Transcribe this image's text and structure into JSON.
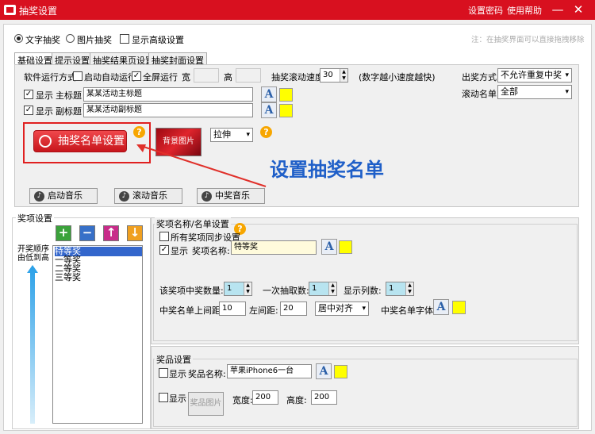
{
  "window": {
    "title": "抽奖设置",
    "links": [
      "设置密码",
      "使用帮助"
    ]
  },
  "mode": {
    "options": [
      "文字抽奖",
      "图片抽奖"
    ],
    "advanced_label": "显示高级设置",
    "hint": "注：在抽奖界面可以直接拖拽移除"
  },
  "tabs": [
    "基础设置",
    "提示设置",
    "抽奖结果页设置",
    "抽奖封面设置"
  ],
  "basic": {
    "run_mode_label": "软件运行方式",
    "auto_start": "启动自动运行",
    "fullscreen": "全屏运行",
    "width_label": "宽",
    "height_label": "高",
    "scroll_speed_label": "抽奖滚动速度",
    "scroll_speed_value": "30",
    "speed_hint": "(数字越小速度越快)",
    "show_label": "显示",
    "main_title_label": "主标题",
    "main_title_value": "某某活动主标题",
    "sub_title_label": "副标题",
    "sub_title_value": "某某活动副标题",
    "list_button": "抽奖名单设置",
    "bg_image": "背景图片",
    "stretch": "拉伸",
    "draw_mode_label": "出奖方式",
    "draw_mode_value": "不允许重复中奖",
    "scroll_list_label": "滚动名单",
    "scroll_list_value": "全部",
    "music_buttons": [
      "启动音乐",
      "滚动音乐",
      "中奖音乐"
    ],
    "annotation": "设置抽奖名单"
  },
  "prizes": {
    "title": "奖项设置",
    "order_label": "开奖顺序\n由低到高",
    "items": [
      "特等奖",
      "一等奖",
      "二等奖",
      "三等奖"
    ]
  },
  "prize_name": {
    "title": "奖项名称/名单设置",
    "sync": "所有奖项同步设置",
    "show": "显示",
    "name_label": "奖项名称:",
    "name_value": "特等奖",
    "winners_label": "该奖项中奖数量:",
    "winners_value": "1",
    "per_draw_label": "一次抽取数:",
    "per_draw_value": "1",
    "columns_label": "显示列数:",
    "columns_value": "1",
    "top_margin_label": "中奖名单上间距:",
    "top_margin_value": "10",
    "left_margin_label": "左间距:",
    "left_margin_value": "20",
    "align_value": "居中对齐",
    "font_label": "中奖名单字体"
  },
  "award": {
    "title": "奖品设置",
    "show": "显示",
    "name_label": "奖品名称:",
    "name_value": "苹果iPhone6一台",
    "image_button": "奖品图片",
    "width_label": "宽度:",
    "width_value": "200",
    "height_label": "高度:",
    "height_value": "200"
  },
  "colors": {
    "titlebar": "#d8101f",
    "accent_red": "#e8343a",
    "annotation_blue": "#1f5fc8"
  }
}
